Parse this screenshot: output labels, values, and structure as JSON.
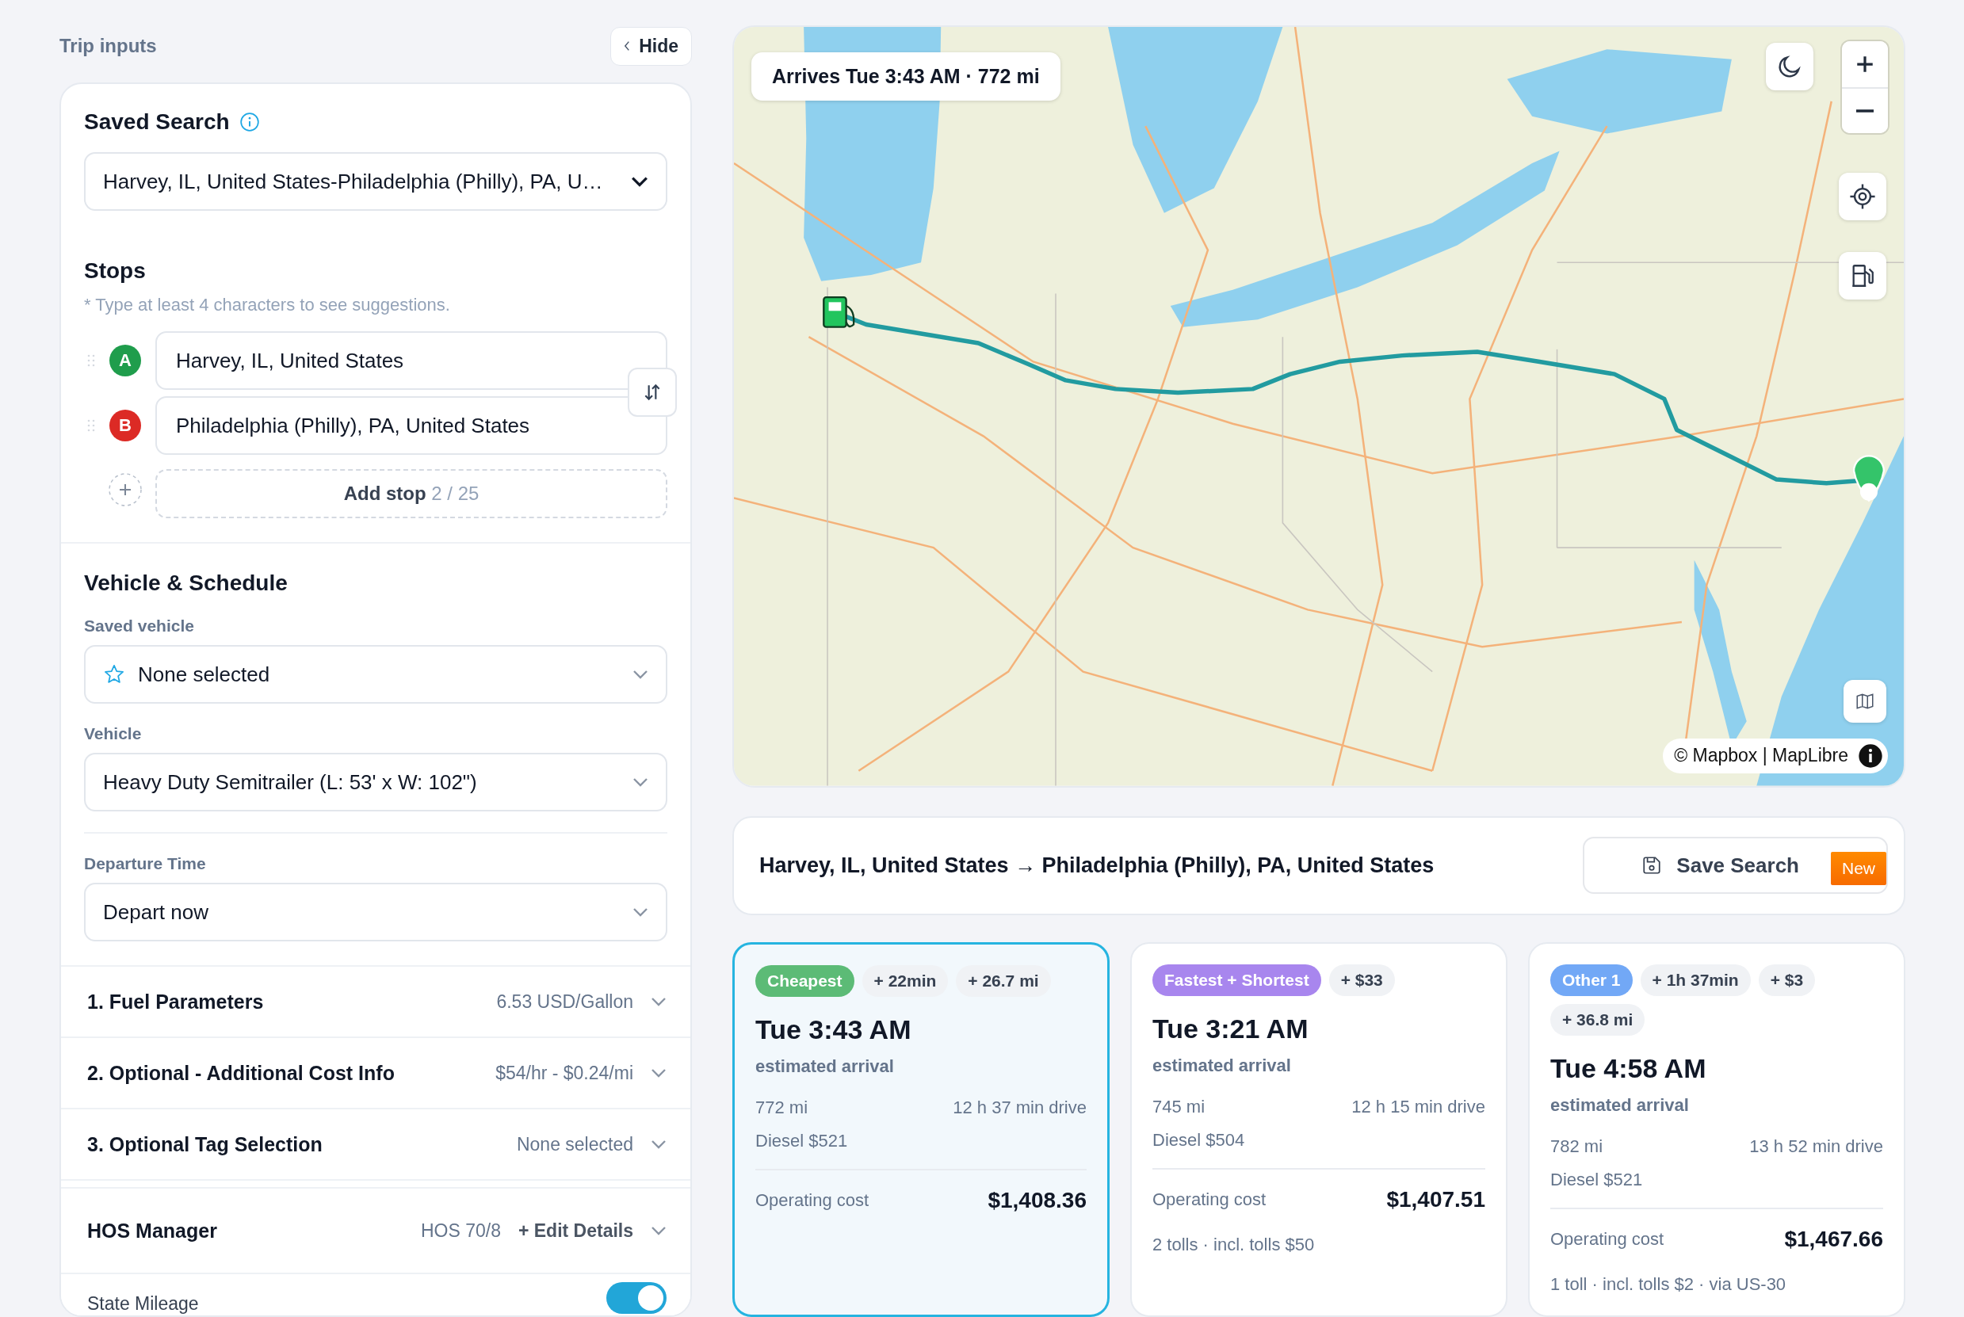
{
  "sidebar": {
    "title": "Trip inputs",
    "hide_button": "Hide",
    "saved_search": {
      "heading": "Saved Search",
      "value": "Harvey, IL, United States-Philadelphia (Philly), PA, U…"
    },
    "stops": {
      "heading": "Stops",
      "hint": "* Type at least 4 characters to see suggestions.",
      "items": [
        {
          "letter": "A",
          "value": "Harvey, IL, United States",
          "color": "#1f9d4c"
        },
        {
          "letter": "B",
          "value": "Philadelphia (Philly), PA, United States",
          "color": "#dc2a25"
        }
      ],
      "add_stop": {
        "label": "Add stop",
        "count": "2 / 25"
      }
    },
    "vehicle_schedule": {
      "heading": "Vehicle & Schedule",
      "fields": [
        {
          "label": "Saved vehicle",
          "value": "None selected",
          "kind": "starred"
        },
        {
          "label": "Vehicle",
          "value": "Heavy Duty Semitrailer (L: 53' x W: 102\")",
          "kind": "plain"
        },
        {
          "label": "Departure Time",
          "value": "Depart now",
          "kind": "plain"
        }
      ]
    },
    "sections": [
      {
        "title": "1. Fuel Parameters",
        "summary": "6.53 USD/Gallon"
      },
      {
        "title": "2. Optional - Additional Cost Info",
        "summary": "$54/hr - $0.24/mi"
      },
      {
        "title": "3. Optional Tag Selection",
        "summary": "None selected"
      }
    ],
    "hos": {
      "title": "HOS Manager",
      "summary": "HOS 70/8",
      "action": "+ Edit Details"
    },
    "state_mileage": {
      "label": "State Mileage",
      "on": true
    }
  },
  "map": {
    "arrival": "Arrives Tue 3:43 AM · 772 mi",
    "attribution": "© Mapbox | MapLibre"
  },
  "summary": {
    "route": "Harvey, IL, United States → Philadelphia (Philly), PA, United States",
    "save_button": "Save Search",
    "badge": "New"
  },
  "routes": [
    {
      "tag": "Cheapest",
      "color": "#5cbb76",
      "chips": [
        "+ 22min",
        "+ 26.7 mi"
      ],
      "time": "Tue 3:43 AM",
      "subtitle": "estimated arrival",
      "distance": "772 mi",
      "drive": "12 h 37 min drive",
      "fuel": "Diesel $521",
      "cost_label": "Operating cost",
      "cost": "$1,408.36",
      "selected": true
    },
    {
      "tag": "Fastest + Shortest",
      "color": "#a886ee",
      "chips": [
        "+ $33"
      ],
      "time": "Tue 3:21 AM",
      "subtitle": "estimated arrival",
      "distance": "745 mi",
      "drive": "12 h 15 min drive",
      "fuel": "Diesel $504",
      "cost_label": "Operating cost",
      "cost": "$1,407.51",
      "tolls": "2 tolls · incl. tolls $50",
      "selected": false
    },
    {
      "tag": "Other 1",
      "color": "#72a8f6",
      "chips": [
        "+ 1h 37min",
        "+ $3",
        "+ 36.8 mi"
      ],
      "time": "Tue 4:58 AM",
      "subtitle": "estimated arrival",
      "distance": "782 mi",
      "drive": "13 h 52 min drive",
      "fuel": "Diesel $521",
      "cost_label": "Operating cost",
      "cost": "$1,467.66",
      "tolls": "1 toll · incl. tolls $2 · via US-30",
      "selected": false
    }
  ]
}
